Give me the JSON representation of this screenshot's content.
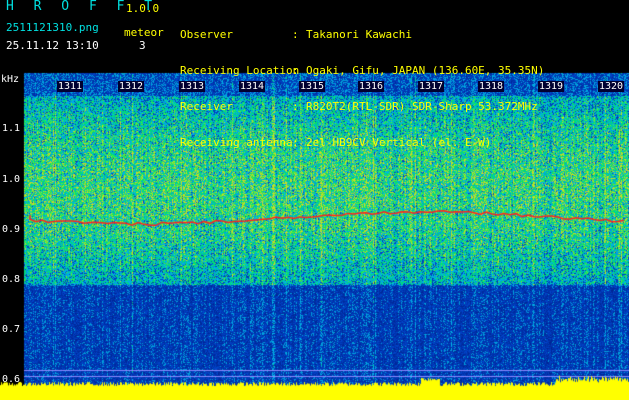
{
  "app": {
    "title": "H R O F F T",
    "version": "1.0.0",
    "filename": "2511121310.png",
    "datetime": "25.11.12 13:10",
    "meteor_label": "meteor",
    "meteor_count": "3"
  },
  "info": [
    {
      "label": "Observer",
      "value": "Takanori Kawachi"
    },
    {
      "label": "Receiving Location",
      "value": "Ogaki, Gifu, JAPAN (136.60E, 35.35N)"
    },
    {
      "label": "Receiver",
      "value": "R820T2(RTL-SDR) SDR-Sharp 53.372MHz"
    },
    {
      "label": "Receiving antenna",
      "value": "2el-HB9CV Vertical (el. E-W)"
    }
  ],
  "spectrogram": {
    "y_unit": "kHz",
    "y_ticks": [
      "1.1",
      "1.0",
      "0.9",
      "0.8",
      "0.7",
      "0.6"
    ],
    "x_ticks": [
      "1311",
      "1312",
      "1313",
      "1314",
      "1315",
      "1316",
      "1317",
      "1318",
      "1319",
      "1320"
    ]
  },
  "colors": {
    "background": "#000000",
    "title": "#00e0e0",
    "label": "#ffff00",
    "value": "#ffffff",
    "noise_floor": "#0a2a9a",
    "signal": "#ff2020",
    "baseline": "#ffff00"
  }
}
